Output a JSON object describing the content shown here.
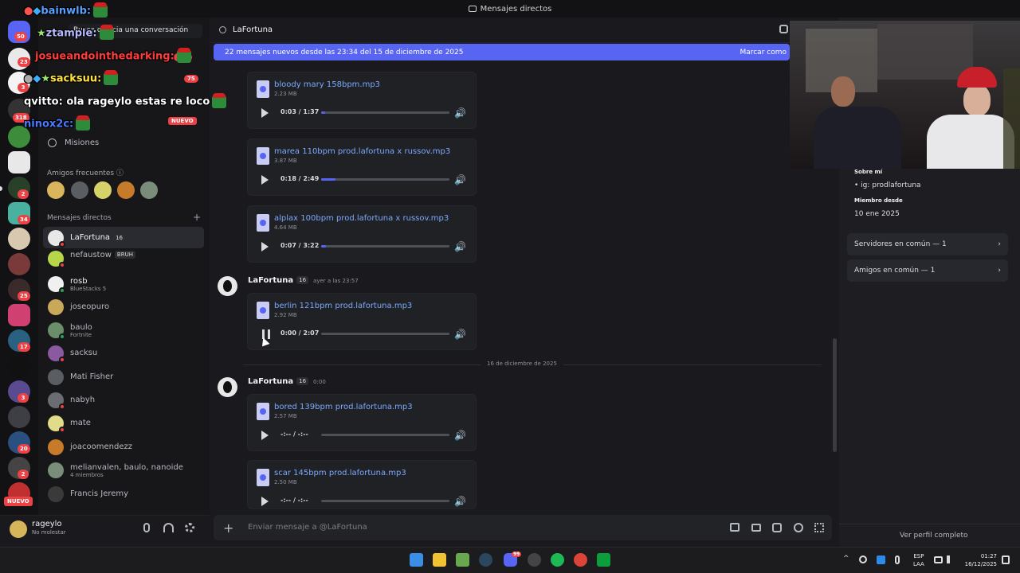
{
  "window": {
    "title": "Mensajes directos"
  },
  "servers": {
    "badges": [
      "50",
      "23",
      "3",
      "318",
      "2",
      "34",
      "25",
      "17",
      "3",
      "20",
      "2"
    ],
    "new_label": "NUEVO"
  },
  "sidebar": {
    "search_placeholder": "Busca o inicia una conversación",
    "hidden_items": {
      "shop_badge": "431",
      "requests_badge": "75",
      "nitro_new": "NUEVO"
    },
    "missions_label": "Misiones",
    "frequent_friends_label": "Amigos frecuentes",
    "dm_header": "Mensajes directos",
    "add_dm": "+",
    "dms": [
      {
        "name": "LaFortuna",
        "tag": "16",
        "sub": "",
        "active": true
      },
      {
        "name": "nefaustow",
        "tag": "BRUH",
        "sub": "",
        "active": false
      },
      {
        "name": "rosb",
        "tag": "",
        "sub": "BlueStacks 5",
        "active": false
      },
      {
        "name": "joseopuro",
        "tag": "",
        "sub": "",
        "active": false
      },
      {
        "name": "baulo",
        "tag": "",
        "sub": "Fortnite",
        "active": false
      },
      {
        "name": "sacksu",
        "tag": "",
        "sub": "",
        "active": false
      },
      {
        "name": "Mati Fisher",
        "tag": "",
        "sub": "",
        "active": false
      },
      {
        "name": "nabyh",
        "tag": "",
        "sub": "",
        "active": false
      },
      {
        "name": "mate",
        "tag": "",
        "sub": "",
        "active": false
      },
      {
        "name": "joacoomendezz",
        "tag": "",
        "sub": "",
        "active": false
      },
      {
        "name": "melianvalen, baulo, nanoide",
        "tag": "",
        "sub": "4 miembros",
        "active": false
      },
      {
        "name": "Francis Jeremy",
        "tag": "",
        "sub": "",
        "active": false
      }
    ]
  },
  "user": {
    "name": "rageylo",
    "status": "No molestar"
  },
  "chat": {
    "header_name": "LaFortuna",
    "banner_text": "22 mensajes nuevos desde las 23:34 del 15 de diciembre de 2025",
    "banner_action": "Marcar como",
    "attachments_top": [
      {
        "name": "bloody mary 158bpm.mp3",
        "size": "2.23 MB",
        "time": "0:03 / 1:37",
        "progress": 0.03,
        "playing": false
      },
      {
        "name": "marea 110bpm prod.lafortuna x russov.mp3",
        "size": "3.87 MB",
        "time": "0:18 / 2:49",
        "progress": 0.11,
        "playing": false
      },
      {
        "name": "alplax 100bpm prod.lafortuna x russov.mp3",
        "size": "4.64 MB",
        "time": "0:07 / 3:22",
        "progress": 0.04,
        "playing": false
      }
    ],
    "msg1": {
      "author": "LaFortuna",
      "tag": "16",
      "timestamp": "ayer a las 23:57"
    },
    "attachment_msg1": {
      "name": "berlin 121bpm prod.lafortuna.mp3",
      "size": "2.92 MB",
      "time": "0:00 / 2:07",
      "progress": 0.0,
      "playing": true
    },
    "date_divider": "16 de diciembre de 2025",
    "msg2": {
      "author": "LaFortuna",
      "tag": "16",
      "timestamp": "0:00"
    },
    "attachments_msg2": [
      {
        "name": "bored 139bpm prod.lafortuna.mp3",
        "size": "2.57 MB",
        "time": "-:-- / -:--",
        "progress": 0.0,
        "playing": false
      },
      {
        "name": "scar 145bpm prod.lafortuna.mp3",
        "size": "2.50 MB",
        "time": "-:-- / -:--",
        "progress": 0.0,
        "playing": false
      }
    ],
    "composer_placeholder": "Enviar mensaje a @LaFortuna"
  },
  "profile": {
    "about_label": "Sobre mí",
    "about_text": "• ig: prodlafortuna",
    "member_since_label": "Miembro desde",
    "member_since": "10 ene 2025",
    "mutual_servers": "Servidores en común — 1",
    "mutual_friends": "Amigos en común — 1",
    "view_full": "Ver perfil completo"
  },
  "overlay": [
    {
      "user": "bainwlb:",
      "color": "#5aa0ff",
      "text": ""
    },
    {
      "user": "ztample:",
      "color": "#b8b8ff",
      "text": ""
    },
    {
      "user": "josueandointhedarking:",
      "color": "#ff3a3a",
      "text": ""
    },
    {
      "user": "sacksuu:",
      "color": "#ffe23a",
      "text": ""
    },
    {
      "user": "qvitto:",
      "color": "#ffffff",
      "text": "ola rageylo estas re loco"
    },
    {
      "user": "ninox2c:",
      "color": "#4a7bff",
      "text": ""
    }
  ],
  "taskbar": {
    "lang": "ESP",
    "lang_sub": "LAA",
    "time": "01:27",
    "date": "16/12/2025",
    "discord_badge": "99",
    "icons": [
      "windows-icon",
      "files-icon",
      "minecraft-icon",
      "steam-icon",
      "discord-icon",
      "obs-icon",
      "spotify-icon",
      "chrome-icon",
      "game-icon"
    ]
  }
}
